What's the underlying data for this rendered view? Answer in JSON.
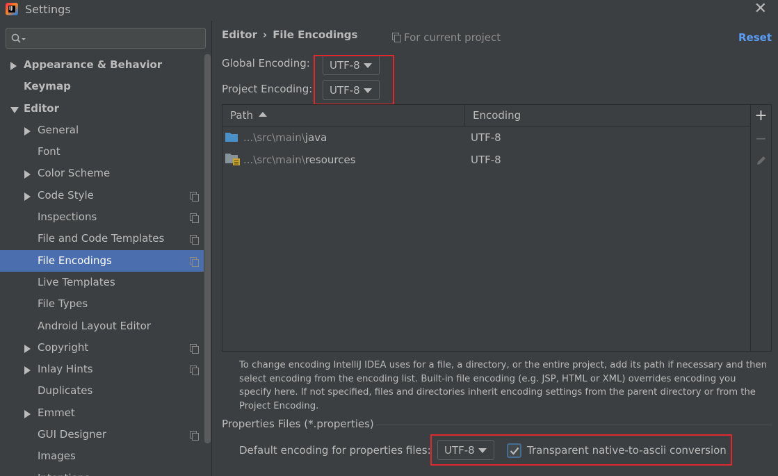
{
  "window": {
    "title": "Settings",
    "app_icon_text": "IJ"
  },
  "search": {
    "value": ""
  },
  "sidebar": {
    "items": [
      {
        "label": "Appearance & Behavior",
        "level": 0,
        "arrow": "right",
        "bold": true,
        "copy": false
      },
      {
        "label": "Keymap",
        "level": 0,
        "arrow": "",
        "bold": true,
        "copy": false
      },
      {
        "label": "Editor",
        "level": 0,
        "arrow": "down",
        "bold": true,
        "copy": false
      },
      {
        "label": "General",
        "level": 1,
        "arrow": "right",
        "bold": false,
        "copy": false
      },
      {
        "label": "Font",
        "level": 1,
        "arrow": "",
        "bold": false,
        "copy": false
      },
      {
        "label": "Color Scheme",
        "level": 1,
        "arrow": "right",
        "bold": false,
        "copy": false
      },
      {
        "label": "Code Style",
        "level": 1,
        "arrow": "right",
        "bold": false,
        "copy": true
      },
      {
        "label": "Inspections",
        "level": 1,
        "arrow": "",
        "bold": false,
        "copy": true
      },
      {
        "label": "File and Code Templates",
        "level": 1,
        "arrow": "",
        "bold": false,
        "copy": true
      },
      {
        "label": "File Encodings",
        "level": 1,
        "arrow": "",
        "bold": false,
        "copy": true,
        "selected": true
      },
      {
        "label": "Live Templates",
        "level": 1,
        "arrow": "",
        "bold": false,
        "copy": false
      },
      {
        "label": "File Types",
        "level": 1,
        "arrow": "",
        "bold": false,
        "copy": false
      },
      {
        "label": "Android Layout Editor",
        "level": 1,
        "arrow": "",
        "bold": false,
        "copy": false
      },
      {
        "label": "Copyright",
        "level": 1,
        "arrow": "right",
        "bold": false,
        "copy": true
      },
      {
        "label": "Inlay Hints",
        "level": 1,
        "arrow": "right",
        "bold": false,
        "copy": true
      },
      {
        "label": "Duplicates",
        "level": 1,
        "arrow": "",
        "bold": false,
        "copy": false
      },
      {
        "label": "Emmet",
        "level": 1,
        "arrow": "right",
        "bold": false,
        "copy": false
      },
      {
        "label": "GUI Designer",
        "level": 1,
        "arrow": "",
        "bold": false,
        "copy": true
      },
      {
        "label": "Images",
        "level": 1,
        "arrow": "",
        "bold": false,
        "copy": false
      },
      {
        "label": "Intentions",
        "level": 1,
        "arrow": "",
        "bold": false,
        "copy": false
      }
    ]
  },
  "main": {
    "breadcrumb": {
      "parent": "Editor",
      "separator": "›",
      "current": "File Encodings"
    },
    "scope_label": "For current project",
    "reset_label": "Reset",
    "global_encoding": {
      "label": "Global Encoding:",
      "value": "UTF-8"
    },
    "project_encoding": {
      "label": "Project Encoding:",
      "value": "UTF-8"
    },
    "table": {
      "columns": {
        "path": "Path",
        "encoding": "Encoding"
      },
      "rows": [
        {
          "prefix": "...\\src\\main\\",
          "name": "java",
          "encoding": "UTF-8",
          "icon": "folder-icon"
        },
        {
          "prefix": "...\\src\\main\\",
          "name": "resources",
          "encoding": "UTF-8",
          "icon": "resources-folder-icon"
        }
      ],
      "toolbar": {
        "add": "+",
        "remove": "−"
      }
    },
    "help_text": "To change encoding IntelliJ IDEA uses for a file, a directory, or the entire project, add its path if necessary and then select encoding from the encoding list. Built-in file encoding (e.g. JSP, HTML or XML) overrides encoding you specify here. If not specified, files and directories inherit encoding settings from the parent directory or from the Project Encoding.",
    "properties": {
      "section_title": "Properties Files (*.properties)",
      "default_label": "Default encoding for properties files:",
      "default_value": "UTF-8",
      "native_to_ascii_label": "Transparent native-to-ascii conversion",
      "native_to_ascii_checked": true
    }
  },
  "colors": {
    "highlight": "#e0292f",
    "selection": "#4b6eaf",
    "link": "#589df6",
    "folder": "#4a90c8"
  }
}
